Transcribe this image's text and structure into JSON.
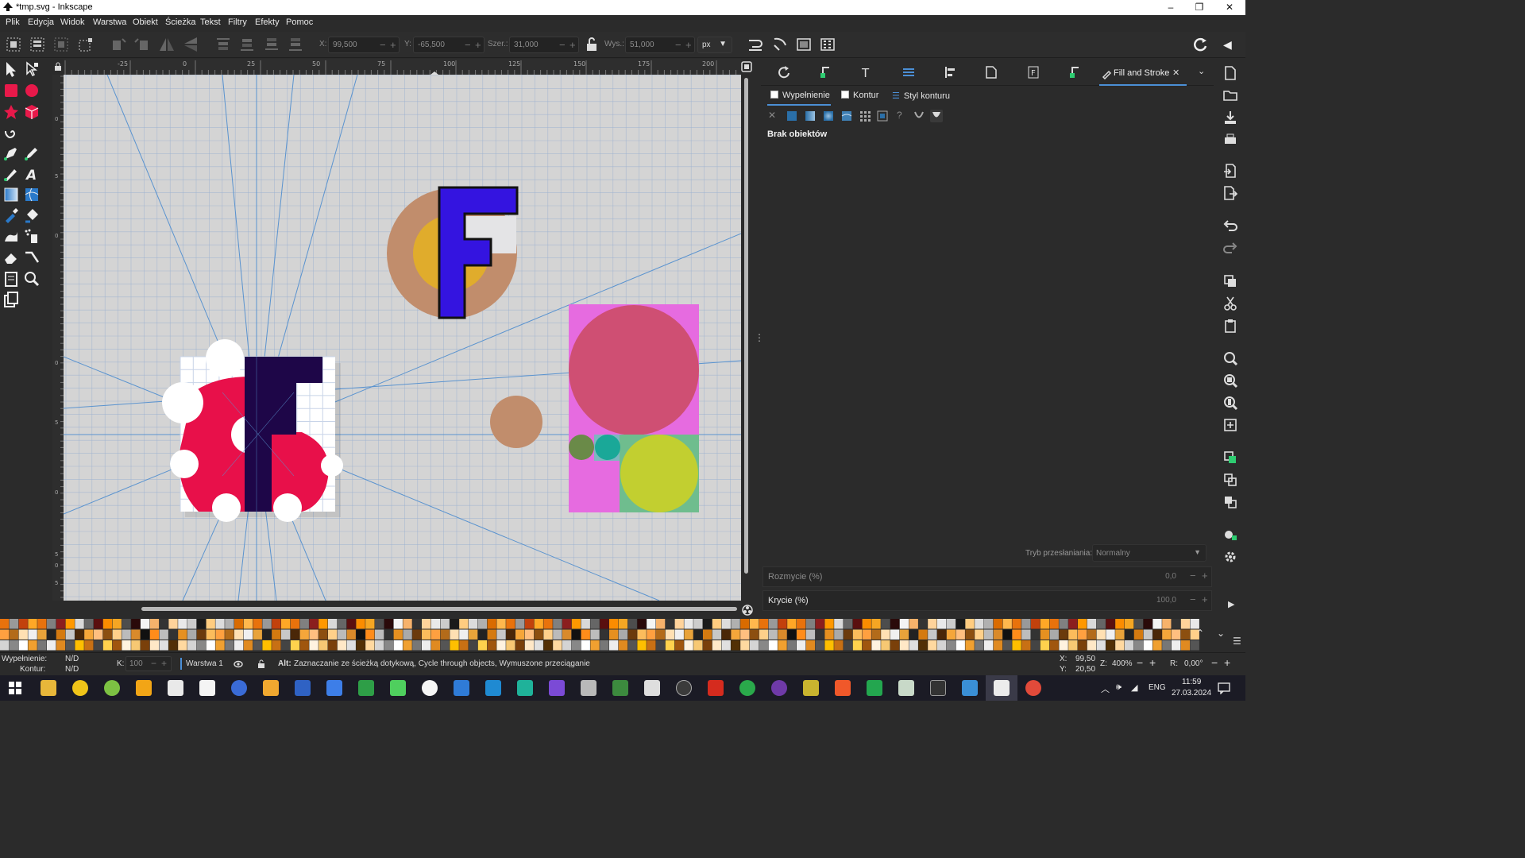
{
  "window": {
    "title": "*tmp.svg - Inkscape",
    "minimize": "–",
    "maximize": "❐",
    "close": "✕"
  },
  "menu": [
    "Plik",
    "Edycja",
    "Widok",
    "Warstwa",
    "Obiekt",
    "Ścieżka",
    "Tekst",
    "Filtry",
    "Efekty",
    "Pomoc"
  ],
  "toolbar": {
    "x_label": "X:",
    "x_value": "99,500",
    "y_label": "Y:",
    "y_value": "-65,500",
    "w_label": "Szer.:",
    "w_value": "31,000",
    "h_label": "Wys.:",
    "h_value": "51,000",
    "unit": "px"
  },
  "ruler_top": [
    "-25",
    "0",
    "25",
    "50",
    "75",
    "100",
    "125",
    "150",
    "175",
    "200"
  ],
  "ruler_left": [
    "0",
    "5",
    "0",
    "0",
    "5",
    "0",
    "5",
    "0",
    "5"
  ],
  "dock": {
    "tab_active": "Fill and Stroke",
    "tab_close": "✕",
    "subtabs": [
      "Wypełnienie",
      "Kontur",
      "Styl konturu"
    ],
    "no_objects": "Brak obiektów",
    "blend_label": "Tryb przesłaniania:",
    "blend_value": "Normalny",
    "blur_label": "Rozmycie (%)",
    "blur_value": "0,0",
    "opacity_label": "Krycie (%)",
    "opacity_value": "100,0"
  },
  "status": {
    "fill_label": "Wypełnienie:",
    "fill_value": "N/D",
    "stroke_label": "Kontur:",
    "stroke_value": "N/D",
    "k_label": "K:",
    "k_value": "100",
    "layer": "Warstwa 1",
    "hint_bold": "Alt:",
    "hint": "Zaznaczanie ze ścieżką dotykową, Cycle through objects, Wymuszone przeciąganie",
    "cx_label": "X:",
    "cx_value": "99,50",
    "cy_label": "Y:",
    "cy_value": "20,50",
    "zoom_label": "Z:",
    "zoom_value": "400%",
    "rot_label": "R:",
    "rot_value": "0,00°"
  },
  "taskbar": {
    "lang": "ENG",
    "time": "11:59",
    "date": "27.03.2024"
  },
  "colors": {
    "accent": "#4b8fd6",
    "canvas_bg": "#d4d4d4",
    "grid": "#9ab0d0",
    "guide": "#5a93cf",
    "letter_blue": "#3414e0",
    "letter_dark": "#1e0648",
    "crimson": "#e8104a",
    "magenta": "#e66be0",
    "tan": "#c18d6c",
    "gold": "#e0ac2c",
    "rose": "#cf4f73",
    "lime": "#c2cf30",
    "teal": "#1aa898",
    "sage": "#6fbd8e"
  }
}
